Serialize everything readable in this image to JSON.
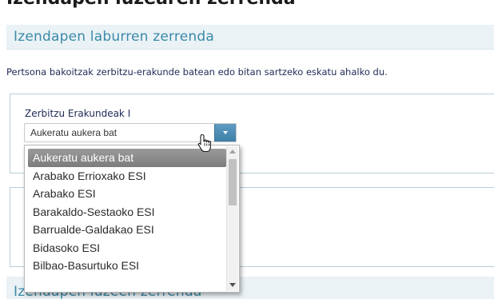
{
  "page": {
    "heading": "Izendapen luzearen zerrenda"
  },
  "short_list_section": {
    "title": "Izendapen laburren zerrenda",
    "instruction": "Pertsona bakoitzak zerbitzu-erakunde batean edo bitan sartzeko eskatu ahalko du."
  },
  "field1": {
    "label": "Zerbitzu Erakundeak I",
    "select_value": "Aukeratu aukera bat"
  },
  "dropdown": {
    "options": [
      "Aukeratu aukera bat",
      "Arabako Errioxako ESI",
      "Arabako ESI",
      "Barakaldo-Sestaoko ESI",
      "Barrualde-Galdakao ESI",
      "Bidasoko ESI",
      "Bilbao-Basurtuko ESI"
    ],
    "selected_index": 0
  },
  "long_list_section": {
    "title": "Izendapen luzeen zerrenda"
  },
  "icons": {
    "select_button": "chevron-down-icon",
    "cursor": "hand-pointer-icon",
    "scroll_up": "scroll-up-arrow-icon",
    "scroll_down": "scroll-down-arrow-icon"
  },
  "colors": {
    "section_title": "#3b8aa8",
    "section_bar": "#eaf2f6",
    "select_button": "#4a89b2",
    "selected_option_bg": "#8a8a8a"
  }
}
